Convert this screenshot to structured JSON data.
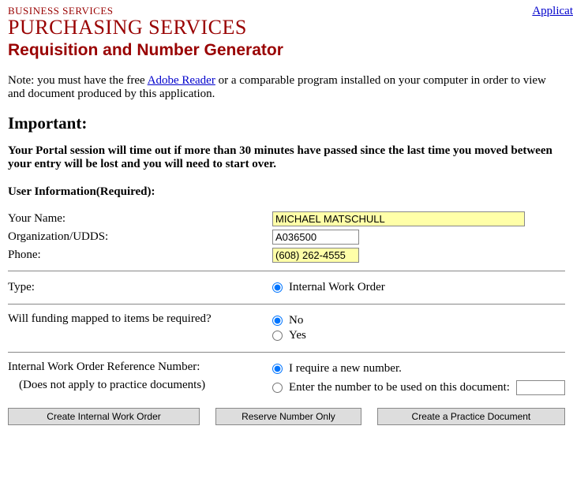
{
  "header": {
    "top_link": "Applicat",
    "brand_small": "BUSINESS SERVICES",
    "brand_large": "PURCHASING SERVICES",
    "page_title": "Requisition and Number Generator"
  },
  "note": {
    "pre": "Note: you must have the free ",
    "link": "Adobe Reader",
    "post": " or a comparable program installed on your computer in order to view and document produced by this application."
  },
  "important": {
    "heading": "Important:",
    "body": "Your Portal session will time out if more than 30 minutes have passed since the last time you moved between your entry will be lost and you will need to start over."
  },
  "user_info": {
    "section_label": "User Information(Required):",
    "name_label": "Your Name:",
    "name_value": "MICHAEL MATSCHULL",
    "udds_label": "Organization/UDDS:",
    "udds_value": "A036500",
    "phone_label": "Phone:",
    "phone_value": "(608) 262-4555"
  },
  "type": {
    "label": "Type:",
    "option_internal": "Internal Work Order"
  },
  "funding": {
    "label": "Will funding mapped to items be required?",
    "no": "No",
    "yes": "Yes"
  },
  "refnum": {
    "label": "Internal Work Order Reference Number:",
    "sublabel": "(Does not apply to practice documents)",
    "opt_new": "I require a new number.",
    "opt_enter": "Enter the number to be used on this document:"
  },
  "buttons": {
    "create_iwo": "Create Internal Work Order",
    "reserve": "Reserve Number Only",
    "practice": "Create a Practice Document"
  }
}
